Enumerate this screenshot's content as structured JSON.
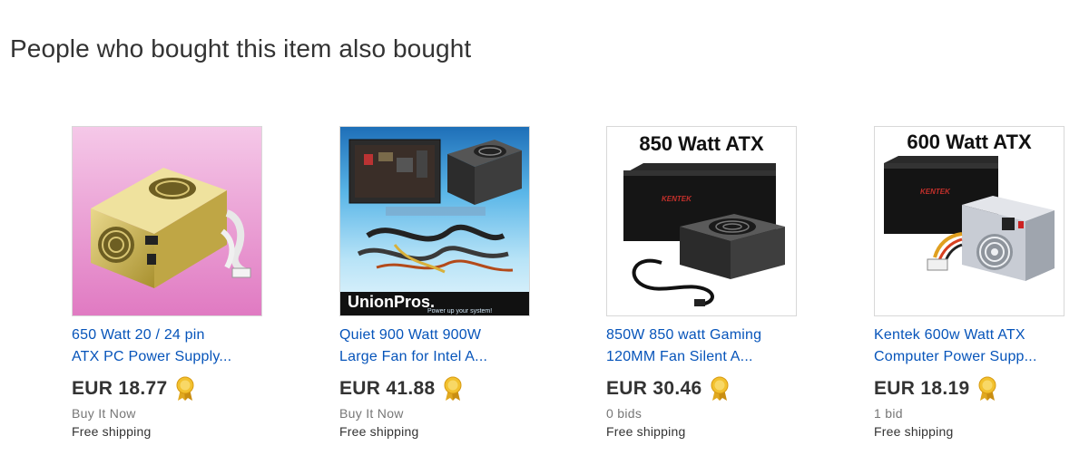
{
  "section": {
    "title": "People who bought this item also bought"
  },
  "items": [
    {
      "image_caption": "",
      "title_line1": "650 Watt 20 / 24 pin",
      "title_line2": "ATX PC Power Supply...",
      "price": "EUR 18.77",
      "format": "Buy It Now",
      "shipping": "Free shipping"
    },
    {
      "image_caption": "UnionPros.",
      "image_subcaption": "Power up your system!",
      "title_line1": "Quiet 900 Watt 900W",
      "title_line2": "Large Fan for Intel A...",
      "price": "EUR 41.88",
      "format": "Buy It Now",
      "shipping": "Free shipping"
    },
    {
      "image_caption": "850 Watt ATX",
      "image_brand": "KENTEK",
      "title_line1": "850W 850 watt Gaming",
      "title_line2": "120MM Fan Silent A...",
      "price": "EUR 30.46",
      "format": "0 bids",
      "shipping": "Free shipping"
    },
    {
      "image_caption": "600 Watt ATX",
      "image_brand": "KENTEK",
      "title_line1": "Kentek 600w Watt ATX",
      "title_line2": "Computer Power Supp...",
      "price": "EUR 18.19",
      "format": "1 bid",
      "shipping": "Free shipping"
    }
  ],
  "colors": {
    "link": "#0654ba",
    "price": "#333333",
    "badge": "#f2c12e"
  },
  "icons": {
    "badge": "top-rated-seller-ribbon-icon"
  }
}
